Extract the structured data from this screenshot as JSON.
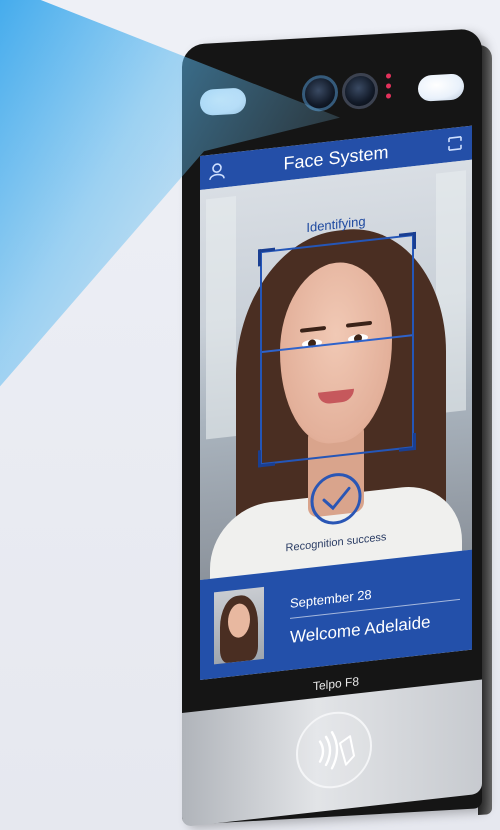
{
  "screen": {
    "title": "Face System",
    "status": "Identifying",
    "result": "Recognition success",
    "date": "September 28",
    "welcome": "Welcome Adelaide"
  },
  "device": {
    "brand": "Telpo F8"
  },
  "colors": {
    "accent": "#244fa8",
    "info_panel": "#2350aa",
    "beam": "#28a0eb",
    "led": "#e3315b"
  },
  "icons": [
    "user-icon",
    "menu-icon",
    "check-circle-icon",
    "nfc-icon"
  ]
}
